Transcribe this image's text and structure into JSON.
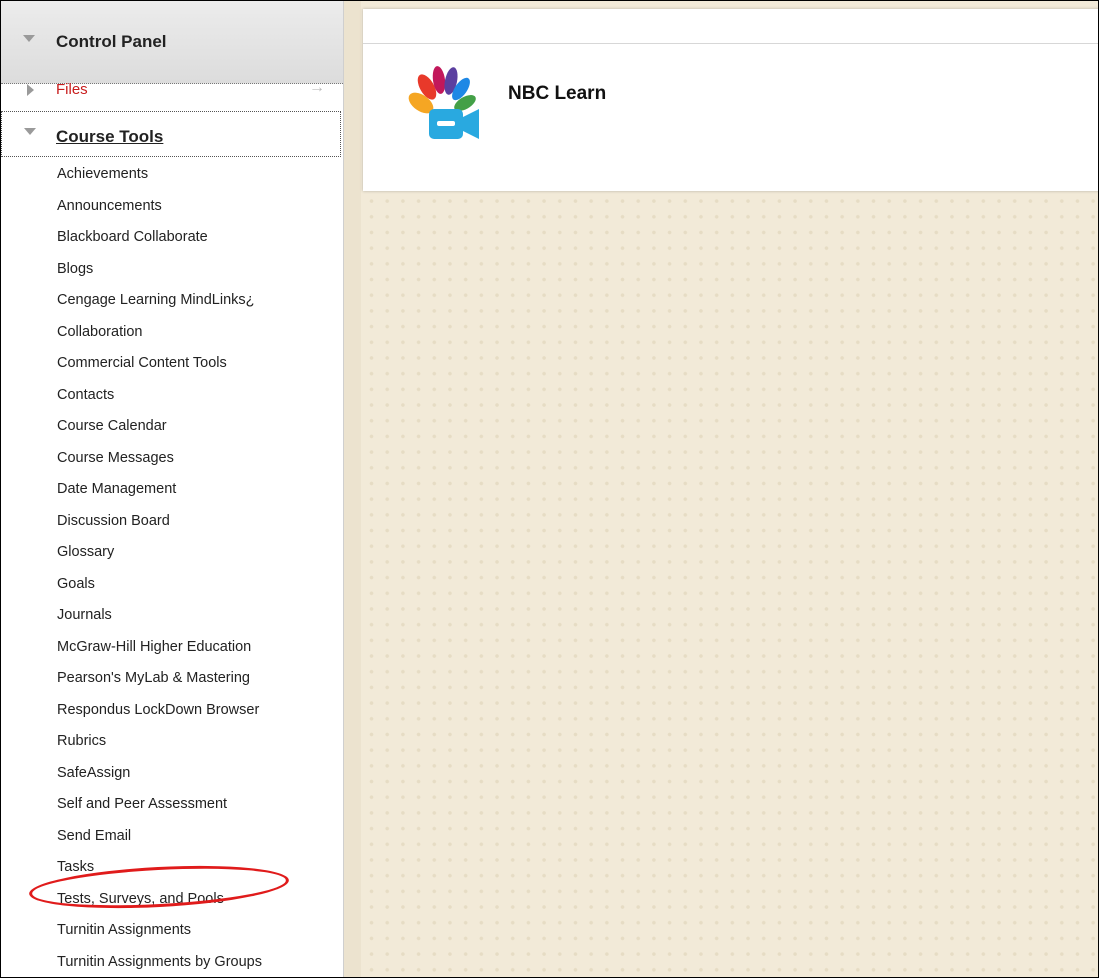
{
  "sidebar": {
    "control_panel_label": "Control Panel",
    "files_label": "Files",
    "files_arrow": "→",
    "course_tools_label": "Course Tools",
    "course_tools_items": [
      "Achievements",
      "Announcements",
      "Blackboard Collaborate",
      "Blogs",
      "Cengage Learning MindLinks¿",
      "Collaboration",
      "Commercial Content Tools",
      "Contacts",
      "Course Calendar",
      "Course Messages",
      "Date Management",
      "Discussion Board",
      "Glossary",
      "Goals",
      "Journals",
      "McGraw-Hill Higher Education",
      "Pearson's MyLab & Mastering",
      "Respondus LockDown Browser",
      "Rubrics",
      "SafeAssign",
      "Self and Peer Assessment",
      "Send Email",
      "Tasks",
      "Tests, Surveys, and Pools",
      "Turnitin Assignments",
      "Turnitin Assignments by Groups"
    ],
    "highlighted_item": "Tests, Surveys, and Pools"
  },
  "main": {
    "module_title": "NBC Learn",
    "module_icon": "nbc-peacock-video-icon"
  },
  "colors": {
    "files_link": "#c81d1d",
    "highlight_ring": "#e01b1b",
    "main_background": "#f2ead8"
  }
}
